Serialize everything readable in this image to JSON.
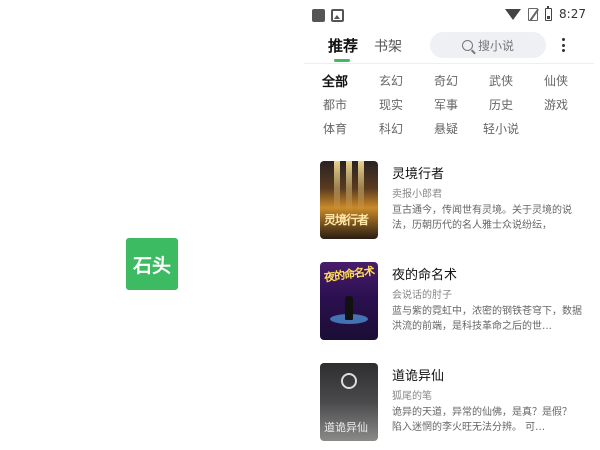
{
  "splash": {
    "logo_text": "石头",
    "logo_color": "#3dbb63"
  },
  "status_bar": {
    "time": "8:27",
    "icons": [
      "notification-square-icon",
      "image-icon",
      "wifi-icon",
      "no-sim-icon",
      "battery-icon"
    ]
  },
  "header": {
    "tabs": [
      {
        "label": "推荐",
        "active": true
      },
      {
        "label": "书架",
        "active": false
      }
    ],
    "search": {
      "placeholder": "搜小说",
      "icon": "search-icon"
    },
    "more_icon": "more-vert-icon",
    "accent_color": "#3dbb63"
  },
  "categories": [
    "全部",
    "玄幻",
    "奇幻",
    "武侠",
    "仙侠",
    "都市",
    "现实",
    "军事",
    "历史",
    "游戏",
    "体育",
    "科幻",
    "悬疑",
    "轻小说"
  ],
  "selected_category": "全部",
  "books": [
    {
      "title": "灵境行者",
      "author": "卖报小郎君",
      "description": "亘古通今，传闻世有灵境。关于灵境的说法，历朝历代的名人雅士众说纷纭，",
      "cover_text": "灵境行者"
    },
    {
      "title": "夜的命名术",
      "author": "会说话的肘子",
      "description": "蓝与紫的霓虹中，浓密的钢铁苍穹下，数据洪流的前端，是科技革命之后的世…",
      "cover_text": "夜的命名术"
    },
    {
      "title": "道诡异仙",
      "author": "狐尾的笔",
      "description": "诡异的天道，异常的仙佛，是真？是假？ 陷入迷惘的李火旺无法分辨。 可…",
      "cover_text": "道诡异仙"
    }
  ]
}
